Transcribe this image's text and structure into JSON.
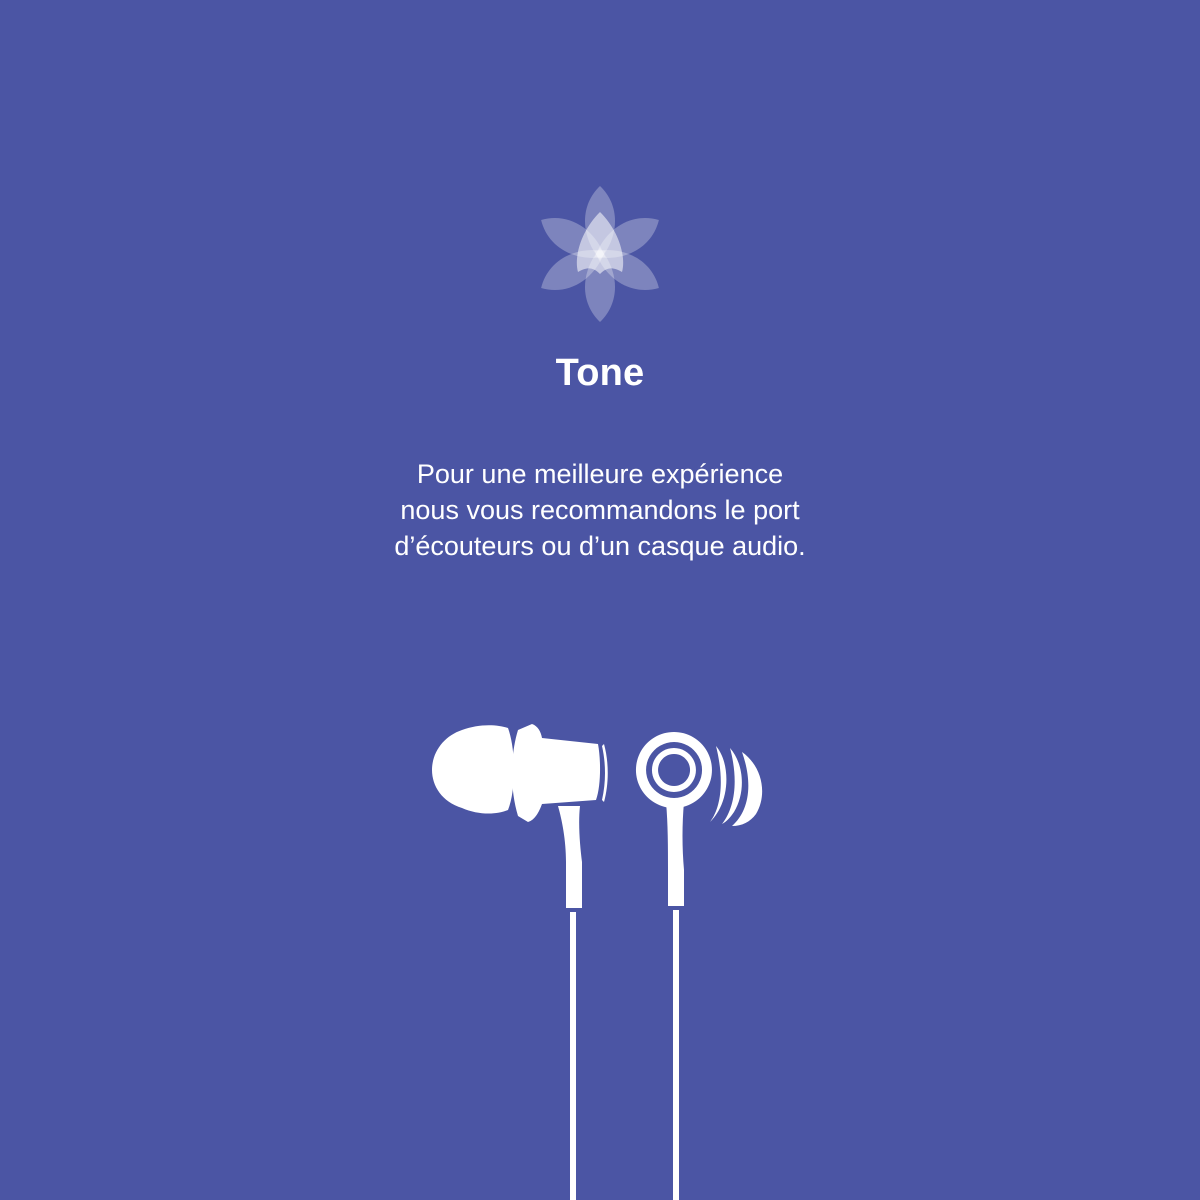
{
  "app": {
    "title": "Tone",
    "logo_icon": "flower-petals-icon"
  },
  "message": {
    "lines": [
      "Pour une meilleure expérience",
      "nous vous recommandons le port",
      "d’écouteurs ou d’un casque audio."
    ]
  },
  "illustration": {
    "icon": "earphones-icon"
  },
  "colors": {
    "background": "#4b55a4",
    "foreground": "#ffffff"
  }
}
